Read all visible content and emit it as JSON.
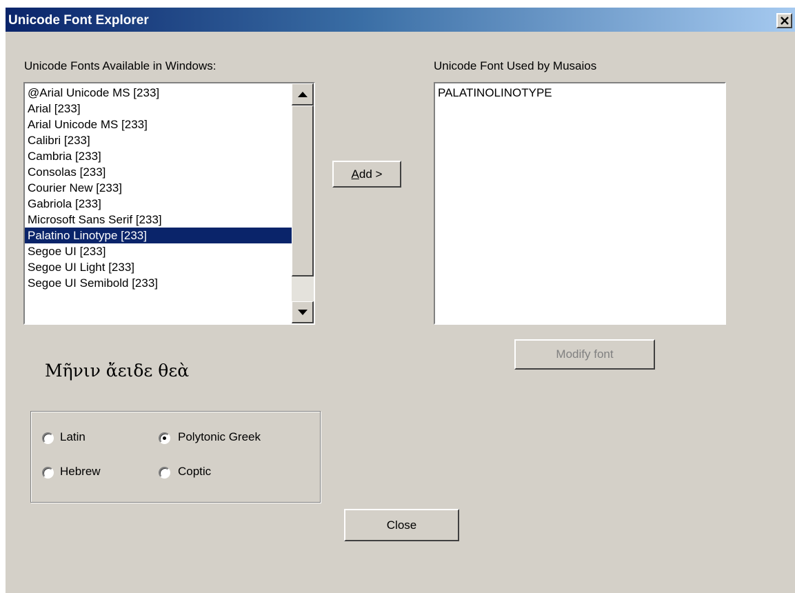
{
  "window": {
    "title": "Unicode Font Explorer"
  },
  "available_fonts": {
    "label": "Unicode Fonts Available in Windows:",
    "items": [
      "@Arial Unicode MS [233]",
      "Arial [233]",
      "Arial Unicode MS [233]",
      "Calibri [233]",
      "Cambria [233]",
      "Consolas [233]",
      "Courier New [233]",
      "Gabriola [233]",
      "Microsoft Sans Serif [233]",
      "Palatino Linotype [233]",
      "Segoe UI [233]",
      "Segoe UI Light [233]",
      "Segoe UI Semibold [233]"
    ],
    "selected_item": "Palatino Linotype [233]"
  },
  "used_fonts": {
    "label": "Unicode Font Used by Musaios",
    "items": [
      "PALATINOLINOTYPE"
    ]
  },
  "buttons": {
    "add_accel": "A",
    "add_rest": "dd >",
    "modify_font": "Modify font",
    "close": "Close"
  },
  "sample_text": "Μῆνιν ἄειδε θεὰ",
  "script_options": {
    "latin": "Latin",
    "polytonic_greek": "Polytonic Greek",
    "hebrew": "Hebrew",
    "coptic": "Coptic",
    "selected": "Polytonic Greek"
  },
  "colors": {
    "titlebar_start": "#0a246a",
    "titlebar_end": "#a6caf0",
    "selection": "#0a246a",
    "face": "#d4d0c8"
  }
}
